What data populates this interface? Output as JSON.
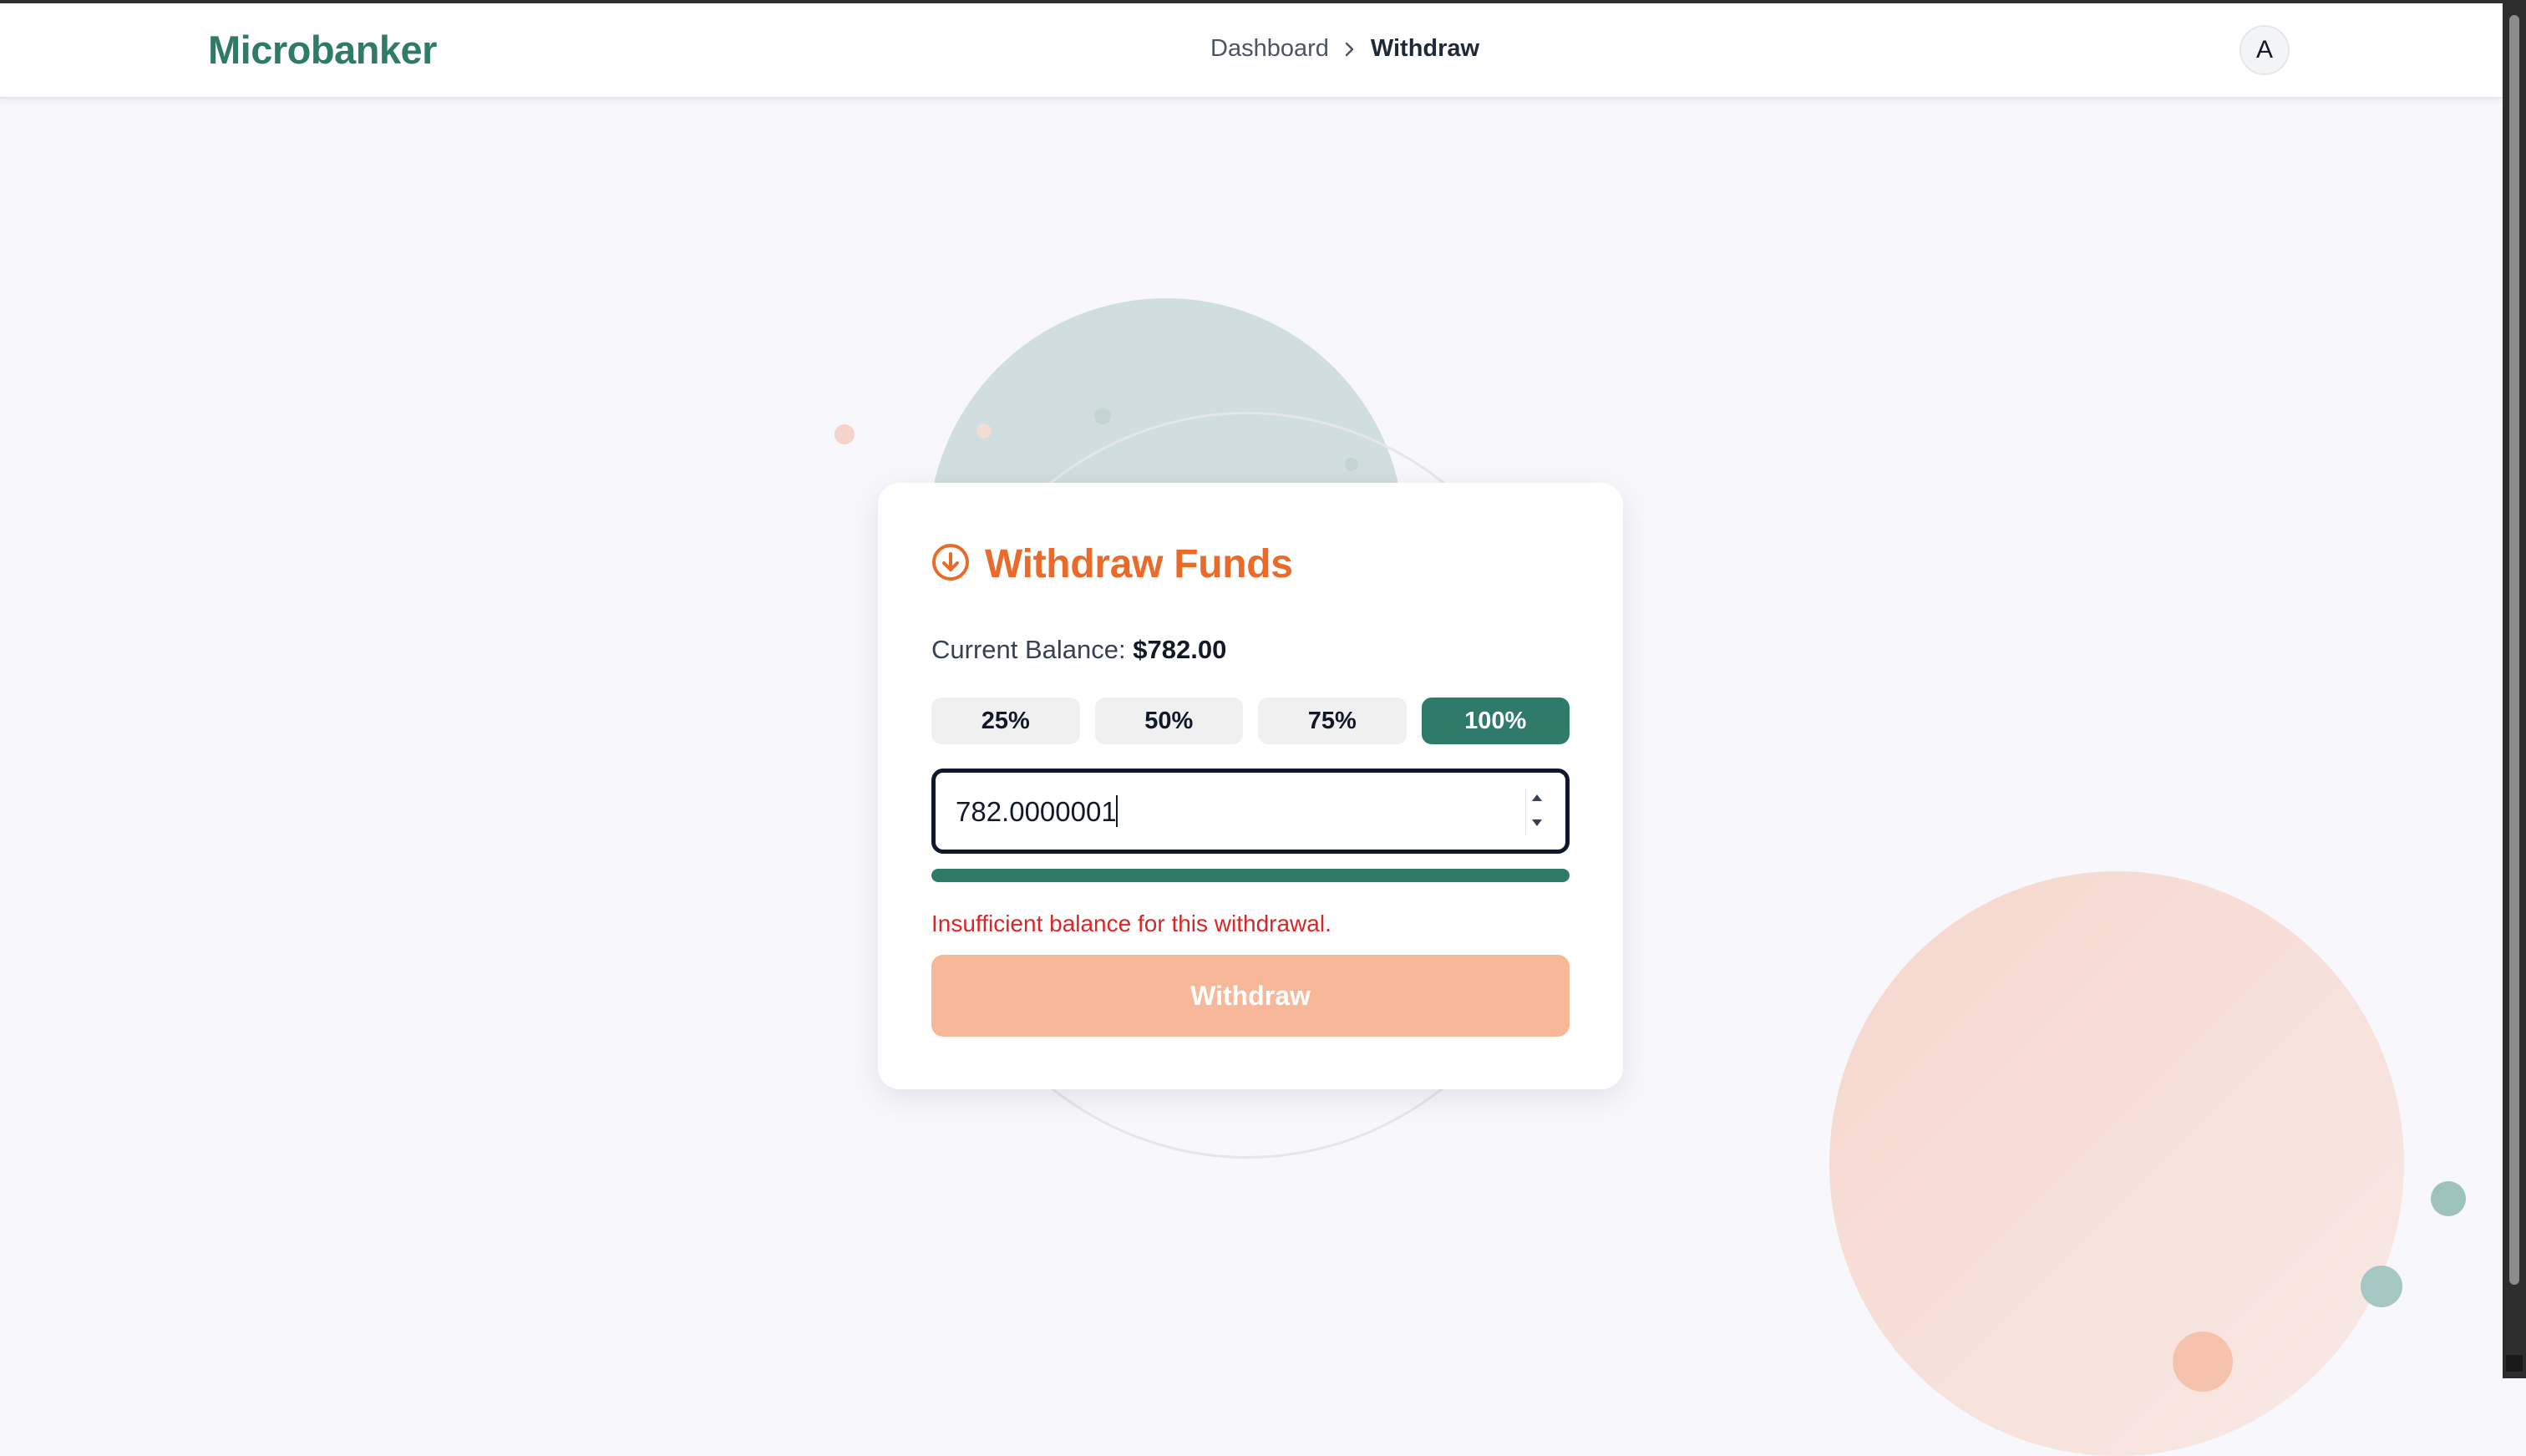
{
  "app": {
    "logo": "Microbanker"
  },
  "breadcrumb": {
    "items": [
      {
        "label": "Dashboard"
      }
    ],
    "current": "Withdraw"
  },
  "user": {
    "avatar_initial": "A"
  },
  "card": {
    "icon": "arrow-down-circle-icon",
    "title": "Withdraw Funds",
    "balance_label": "Current Balance:",
    "balance_value": "$782.00",
    "percent_buttons": [
      {
        "label": "25%",
        "active": false
      },
      {
        "label": "50%",
        "active": false
      },
      {
        "label": "75%",
        "active": false
      },
      {
        "label": "100%",
        "active": true
      }
    ],
    "amount_value": "782.0000001",
    "progress_fraction": 1.0,
    "error_message": "Insufficient balance for this withdrawal.",
    "submit_label": "Withdraw"
  },
  "colors": {
    "brand": "#2f7a68",
    "accent": "#ea6a2a",
    "error": "#dc2626",
    "submit_disabled": "#f6b899",
    "background": "#f7f7fc"
  }
}
